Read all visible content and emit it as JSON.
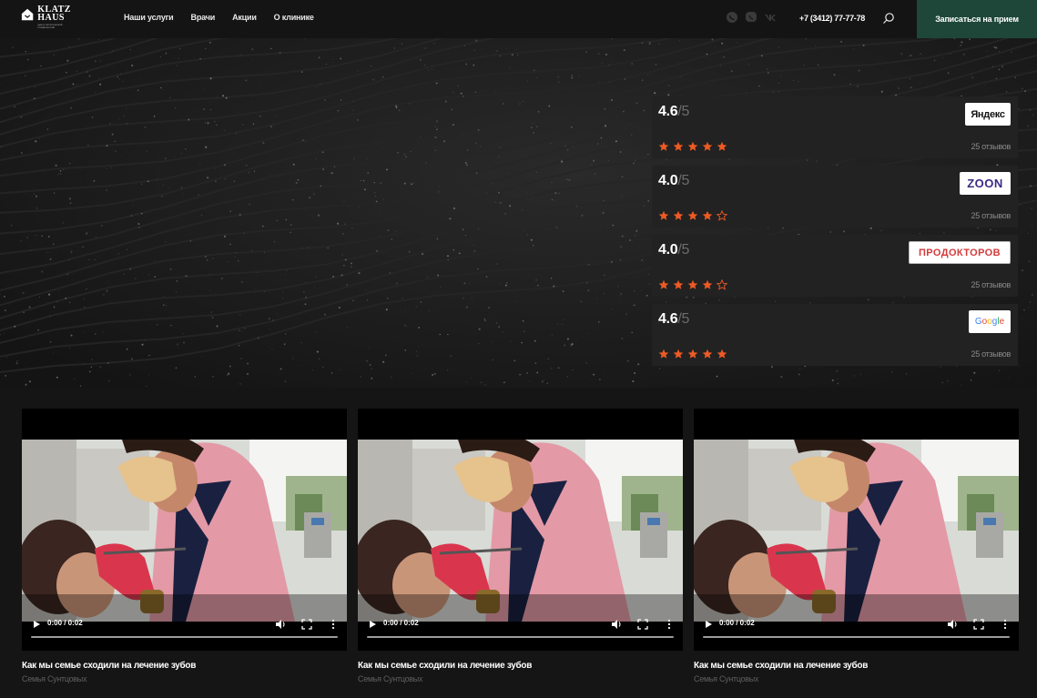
{
  "header": {
    "logo": {
      "line1": "KLATZ",
      "line2": "HAUS",
      "tagline": "центр эстетической стоматологии"
    },
    "nav": [
      "Наши услуги",
      "Врачи",
      "Акции",
      "О клинике"
    ],
    "socials": [
      "whatsapp-icon",
      "viber-icon",
      "vk-icon"
    ],
    "phone": "+7 (3412) 77-77-78",
    "cta_label": "Записаться на прием"
  },
  "ratings": [
    {
      "source": "Яндекс",
      "score": "4.6",
      "max": "/5",
      "stars": 5,
      "count": "25 отзывов"
    },
    {
      "source": "ZOON",
      "score": "4.0",
      "max": "/5",
      "stars": 4,
      "count": "25 отзывов"
    },
    {
      "source": "ПРОДОКТОРОВ",
      "score": "4.0",
      "max": "/5",
      "stars": 4,
      "count": "25 отзывов"
    },
    {
      "source": "Google",
      "score": "4.6",
      "max": "/5",
      "stars": 5,
      "count": "25 отзывов"
    }
  ],
  "colors": {
    "accent": "#1e4739",
    "star": "#ee5a24",
    "card": "#222222"
  },
  "videos": [
    {
      "time": "0:00 / 0:02",
      "title": "Как мы семье сходили на лечение зубов",
      "subtitle": "Семья Сунтцовых"
    },
    {
      "time": "0:00 / 0:02",
      "title": "Как мы семье сходили на лечение зубов",
      "subtitle": "Семья Сунтцовых"
    },
    {
      "time": "0:00 / 0:02",
      "title": "Как мы семье сходили на лечение зубов",
      "subtitle": "Семья Сунтцовых"
    }
  ]
}
